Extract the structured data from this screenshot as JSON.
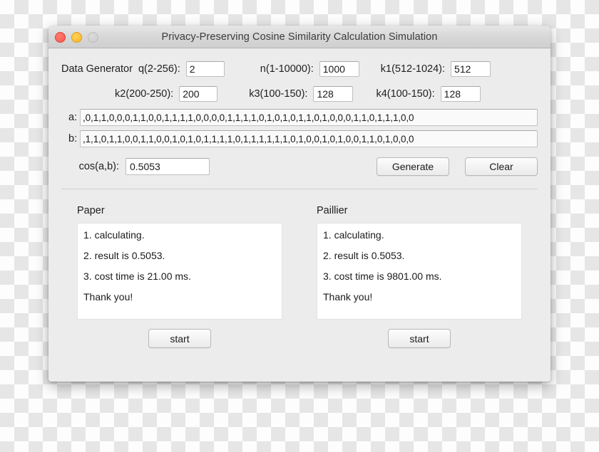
{
  "window": {
    "title": "Privacy-Preserving Cosine Similarity Calculation Simulation",
    "traffic_lights": {
      "close": "close-button",
      "minimize": "minimize-button",
      "zoom": "zoom-button"
    }
  },
  "generator": {
    "section_label": "Data Generator",
    "fields": [
      {
        "label": "q(2-256):",
        "value": "2"
      },
      {
        "label": "n(1-10000):",
        "value": "1000"
      },
      {
        "label": "k1(512-1024):",
        "value": "512"
      },
      {
        "label": "k2(200-250):",
        "value": "200"
      },
      {
        "label": "k3(100-150):",
        "value": "128"
      },
      {
        "label": "k4(100-150):",
        "value": "128"
      }
    ]
  },
  "vectors": {
    "a": {
      "label": "a:",
      "value": ",0,1,1,0,0,0,1,1,0,0,1,1,1,1,0,0,0,0,1,1,1,1,0,1,0,1,0,1,1,0,1,0,0,0,1,1,0,1,1,1,0,0"
    },
    "b": {
      "label": "b:",
      "value": ",1,1,0,1,1,0,0,1,1,0,0,1,0,1,0,1,1,1,1,0,1,1,1,1,1,1,0,1,0,0,1,0,1,0,0,1,1,0,1,0,0,0"
    }
  },
  "cosine": {
    "label": "cos(a,b):",
    "value": "0.5053"
  },
  "actions": {
    "generate_label": "Generate",
    "clear_label": "Clear"
  },
  "results": {
    "paper": {
      "title": "Paper",
      "lines": [
        "1. calculating.",
        "2. result is 0.5053.",
        "3. cost time is 21.00 ms.",
        "Thank you!"
      ],
      "start_label": "start"
    },
    "paillier": {
      "title": "Paillier",
      "lines": [
        "1. calculating.",
        "2. result is 0.5053.",
        "3. cost time is 9801.00 ms.",
        "Thank you!"
      ],
      "start_label": "start"
    }
  },
  "colors": {
    "window_bg": "#ececec",
    "titlebar_top": "#e6e6e6",
    "titlebar_bottom": "#cfcfcf",
    "close_light": "#f9544b",
    "min_light": "#f8b72a",
    "zoom_light": "#cbcbcb",
    "field_bg": "#ffffff",
    "text": "#1a1a1a"
  }
}
